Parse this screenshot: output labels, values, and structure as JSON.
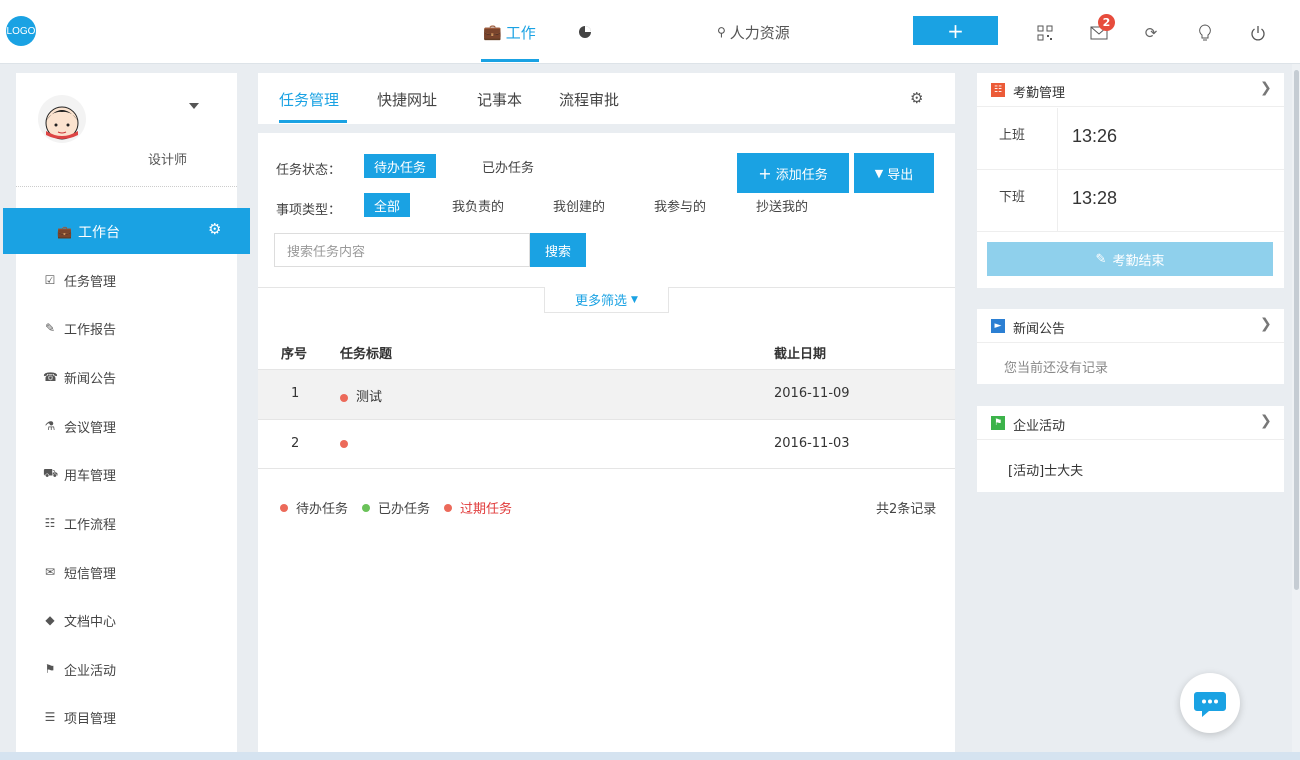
{
  "topbar": {
    "logo": "LOGO",
    "nav_work": "工作",
    "nav_hr": "人力资源",
    "plus": "+",
    "mail_badge": "2"
  },
  "sidebar": {
    "role": "设计师",
    "active_item": "工作台",
    "items": [
      {
        "label": "任务管理",
        "icon": "task-check-icon"
      },
      {
        "label": "工作报告",
        "icon": "report-icon"
      },
      {
        "label": "新闻公告",
        "icon": "megaphone-icon"
      },
      {
        "label": "会议管理",
        "icon": "meeting-icon"
      },
      {
        "label": "用车管理",
        "icon": "car-icon"
      },
      {
        "label": "工作流程",
        "icon": "flow-icon"
      },
      {
        "label": "短信管理",
        "icon": "envelope-icon"
      },
      {
        "label": "文档中心",
        "icon": "layers-icon"
      },
      {
        "label": "企业活动",
        "icon": "flag-icon"
      },
      {
        "label": "项目管理",
        "icon": "project-icon"
      }
    ]
  },
  "tabs": {
    "items": [
      "任务管理",
      "快捷网址",
      "记事本",
      "流程审批"
    ],
    "active": "任务管理"
  },
  "filters": {
    "status_label": "任务状态：",
    "status_options": [
      "待办任务",
      "已办任务"
    ],
    "type_label": "事项类型：",
    "type_options": [
      "全部",
      "我负责的",
      "我创建的",
      "我参与的",
      "抄送我的"
    ],
    "add_task": "添加任务",
    "export": "导出",
    "search_placeholder": "搜索任务内容",
    "search_button": "搜索",
    "more_filter": "更多筛选"
  },
  "table": {
    "headers": [
      "序号",
      "任务标题",
      "截止日期"
    ],
    "rows": [
      {
        "no": "1",
        "title": "测试",
        "due": "2016-11-09",
        "status_color": "#ec6a5a"
      },
      {
        "no": "2",
        "title": "",
        "due": "2016-11-03",
        "status_color": "#ec6a5a"
      }
    ]
  },
  "legend": {
    "items": [
      {
        "label": "待办任务",
        "color": "#ec6a5a"
      },
      {
        "label": "已办任务",
        "color": "#6ac259"
      },
      {
        "label": "过期任务",
        "color": "#ec6a5a"
      }
    ],
    "count": "共2条记录"
  },
  "attendance": {
    "title": "考勤管理",
    "on_label": "上班",
    "on_time": "13:26",
    "off_label": "下班",
    "off_time": "13:28",
    "end_button": "考勤结束"
  },
  "news": {
    "title": "新闻公告",
    "empty": "您当前还没有记录"
  },
  "activity": {
    "title": "企业活动",
    "item": "[活动]士大夫"
  },
  "colors": {
    "accent": "#1aa2e3",
    "attendance_icon": "#ec5b38",
    "news_icon": "#2b7fd3",
    "activity_icon": "#3cb34a"
  }
}
